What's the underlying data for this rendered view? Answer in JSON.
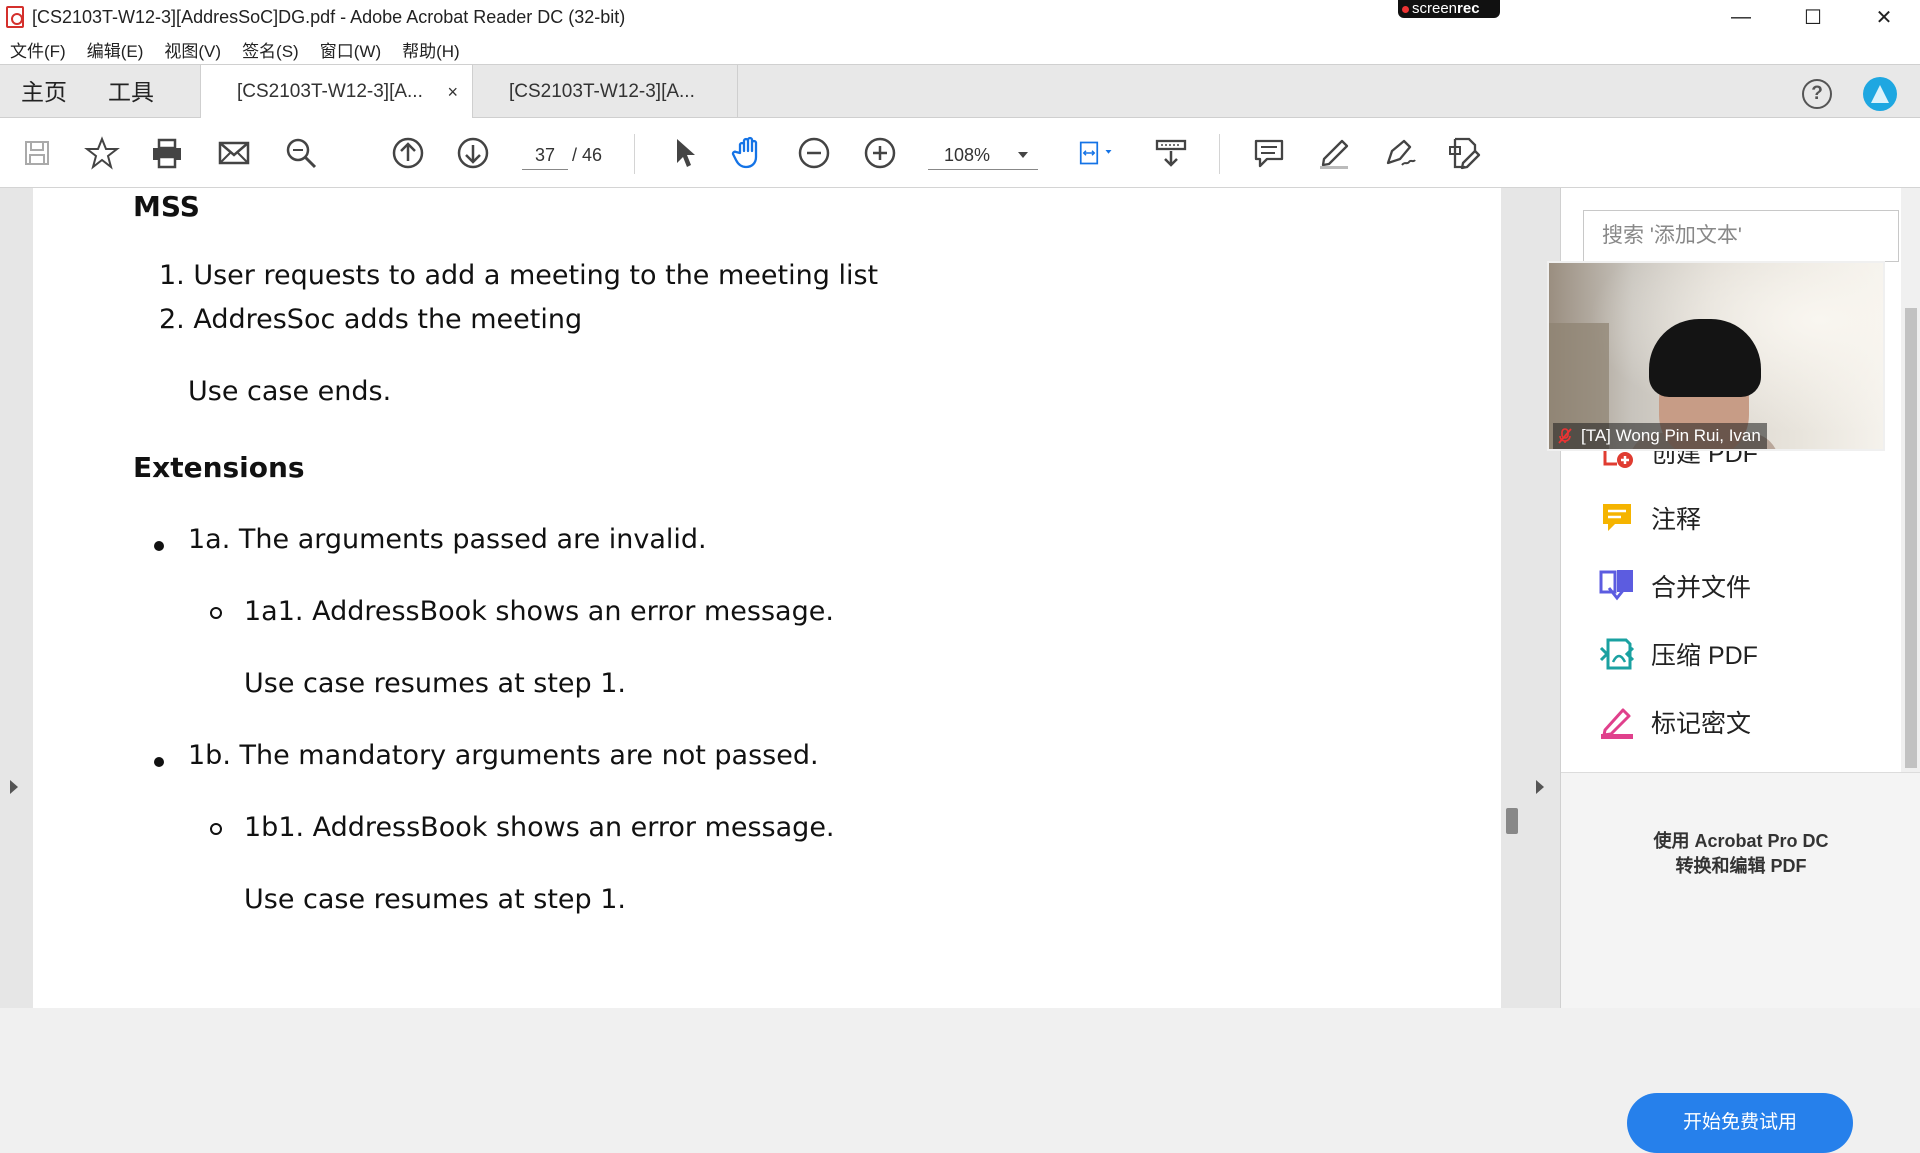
{
  "window": {
    "title": "[CS2103T-W12-3][AddresSoC]DG.pdf - Adobe Acrobat Reader DC (32-bit)",
    "recorder_badge_prefix": "screen",
    "recorder_badge_suffix": "rec",
    "controls": {
      "minimize": "—",
      "maximize": "☐",
      "close": "✕"
    }
  },
  "menubar": {
    "items": [
      "文件(F)",
      "编辑(E)",
      "视图(V)",
      "签名(S)",
      "窗口(W)",
      "帮助(H)"
    ]
  },
  "tabs": {
    "home": "主页",
    "tools": "工具",
    "documents": [
      {
        "label": "[CS2103T-W12-3][A...",
        "active": true,
        "close": "×"
      },
      {
        "label": "[CS2103T-W12-3][A...",
        "active": false
      }
    ]
  },
  "toolbar": {
    "icons": [
      "save-icon",
      "star-icon",
      "print-icon",
      "mail-icon",
      "search-icon",
      "page-up-icon",
      "page-down-icon",
      "select-icon",
      "hand-icon",
      "zoom-out-icon",
      "zoom-in-icon",
      "fit-page-icon",
      "scroll-mode-icon",
      "comment-icon",
      "highlight-icon",
      "sign-icon",
      "fill-sign-icon"
    ],
    "current_page": "37",
    "total_pages": "/ 46",
    "zoom": "108%"
  },
  "document": {
    "mss_heading": "MSS",
    "mss_steps": [
      "1. User requests to add a meeting to the meeting list",
      "2. AddresSoc adds the meeting"
    ],
    "mss_end": "Use case ends.",
    "ext_heading": "Extensions",
    "extensions": [
      {
        "text": "1a. The arguments passed are invalid.",
        "sub": "1a1. AddressBook shows an error message.",
        "resume": "Use case resumes at step 1."
      },
      {
        "text": "1b. The mandatory arguments are not passed.",
        "sub": "1b1. AddressBook shows an error message.",
        "resume": "Use case resumes at step 1."
      }
    ]
  },
  "right_pane": {
    "search_placeholder": "搜索 '添加文本'",
    "items": [
      {
        "label": "创建 PDF",
        "icon": "create-pdf-icon",
        "color": "#e03c31"
      },
      {
        "label": "注释",
        "icon": "comment-tool-icon",
        "color": "#f5b400"
      },
      {
        "label": "合并文件",
        "icon": "combine-files-icon",
        "color": "#5c5ce0"
      },
      {
        "label": "压缩 PDF",
        "icon": "compress-pdf-icon",
        "color": "#1aa1a1"
      },
      {
        "label": "标记密文",
        "icon": "redact-icon",
        "color": "#e0408c"
      }
    ],
    "promo_line1": "使用 Acrobat Pro DC",
    "promo_line2": "转换和编辑 PDF",
    "try_button": "开始免费试用"
  },
  "webcam": {
    "participant": "[TA] Wong Pin Rui, Ivan"
  },
  "colors": {
    "accent": "#2680eb",
    "acrobat_red": "#d4302c",
    "profile_blue": "#1ea7e1"
  }
}
